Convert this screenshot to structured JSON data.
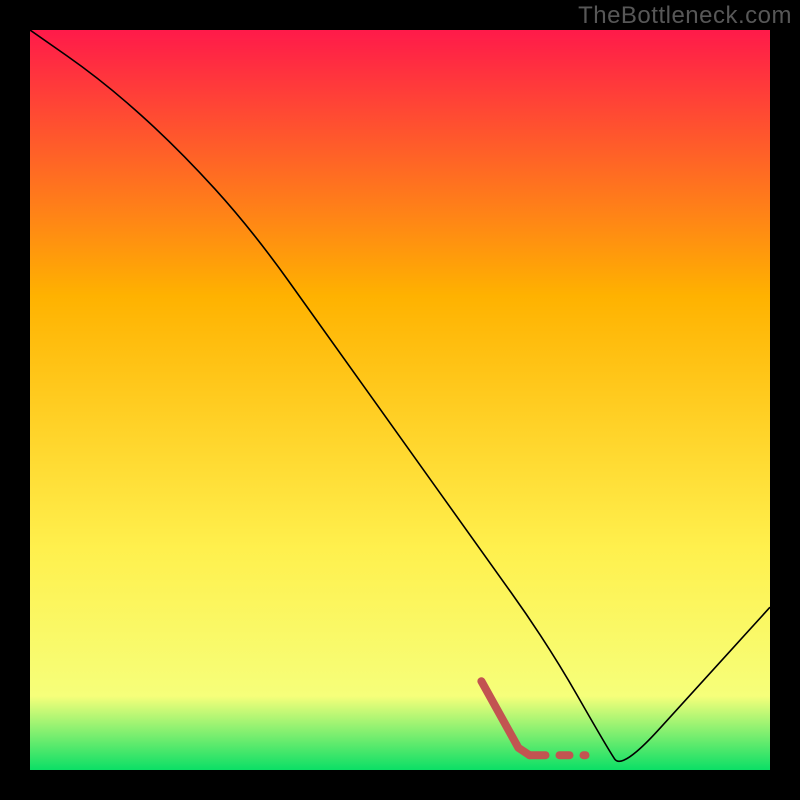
{
  "attribution": "TheBottleneck.com",
  "chart_data": {
    "type": "line",
    "title": "",
    "xlabel": "",
    "ylabel": "",
    "xlim": [
      0,
      100
    ],
    "ylim": [
      0,
      100
    ],
    "grid": false,
    "legend": false,
    "background_gradient": {
      "top_color": "#ff1a4a",
      "mid_upper_color": "#ffb200",
      "mid_lower_color": "#fff04d",
      "near_bottom_color": "#f6ff7a",
      "base_color": "#0bdf66"
    },
    "series": [
      {
        "name": "bottleneck-curve",
        "color": "#000000",
        "stroke_width": 1.6,
        "x": [
          0,
          10,
          20,
          30,
          40,
          50,
          60,
          70,
          78,
          80,
          90,
          100
        ],
        "y": [
          100,
          93,
          84,
          73,
          59,
          45,
          31,
          17,
          3,
          0,
          11,
          22
        ]
      },
      {
        "name": "highlight-segment",
        "color": "#c25451",
        "stroke_width": 8,
        "style": "solid-then-dashed",
        "x": [
          61,
          66,
          67.5,
          71,
          74.5,
          78
        ],
        "y": [
          12,
          3,
          2,
          2,
          2,
          2
        ]
      }
    ]
  }
}
